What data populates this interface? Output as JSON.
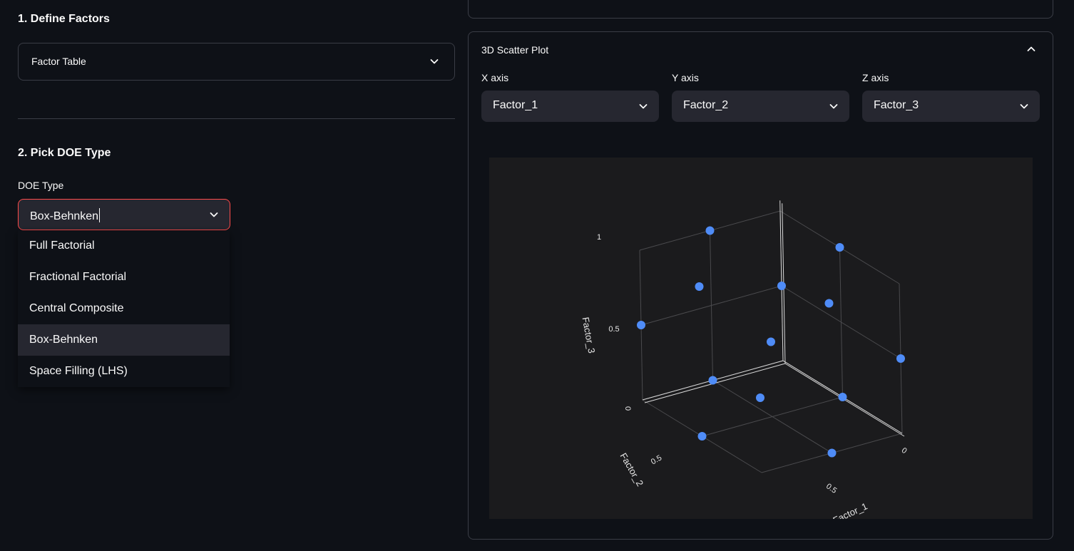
{
  "left": {
    "define_heading": "1. Define Factors",
    "factor_table_label": "Factor Table",
    "pick_heading": "2. Pick DOE Type",
    "doe_label": "DOE Type",
    "doe_value": "Box-Behnken",
    "doe_options": [
      "Full Factorial",
      "Fractional Factorial",
      "Central Composite",
      "Box-Behnken",
      "Space Filling (LHS)"
    ],
    "doe_selected_index": 3
  },
  "scatter": {
    "title": "3D Scatter Plot",
    "x_label": "X axis",
    "x_value": "Factor_1",
    "y_label": "Y axis",
    "y_value": "Factor_2",
    "z_label": "Z axis",
    "z_value": "Factor_3"
  },
  "colors": {
    "background": "#0e1117",
    "widget": "#262730",
    "accent_border": "#ff4b4b",
    "plot_bg": "#1b1b1d",
    "marker": "#4f8cf7"
  },
  "icons": {
    "factor_expander": "chevron-down-icon",
    "doe_select": "chevron-down-icon",
    "scatter_expander": "chevron-up-icon",
    "axis_select": "chevron-down-icon"
  },
  "chart_data": {
    "type": "scatter",
    "projection": "3d",
    "xlabel": "Factor_1",
    "ylabel": "Factor_2",
    "zlabel": "Factor_3",
    "x_ticks": [
      "0",
      "0.5"
    ],
    "y_ticks": [
      "0",
      "0.5"
    ],
    "z_ticks": [
      "0",
      "0.5",
      "1"
    ],
    "xlim": [
      0,
      1
    ],
    "ylim": [
      0,
      1
    ],
    "zlim": [
      0,
      1
    ],
    "points": [
      {
        "x": 0,
        "y": 0,
        "z": 0.5
      },
      {
        "x": 1,
        "y": 0,
        "z": 0.5
      },
      {
        "x": 0,
        "y": 1,
        "z": 0.5
      },
      {
        "x": 1,
        "y": 1,
        "z": 0.5
      },
      {
        "x": 0,
        "y": 0.5,
        "z": 0
      },
      {
        "x": 1,
        "y": 0.5,
        "z": 0
      },
      {
        "x": 0,
        "y": 0.5,
        "z": 1
      },
      {
        "x": 1,
        "y": 0.5,
        "z": 1
      },
      {
        "x": 0.5,
        "y": 0,
        "z": 0
      },
      {
        "x": 0.5,
        "y": 1,
        "z": 0
      },
      {
        "x": 0.5,
        "y": 0,
        "z": 1
      },
      {
        "x": 0.5,
        "y": 1,
        "z": 1
      },
      {
        "x": 0.5,
        "y": 0.5,
        "z": 0.5
      }
    ]
  }
}
